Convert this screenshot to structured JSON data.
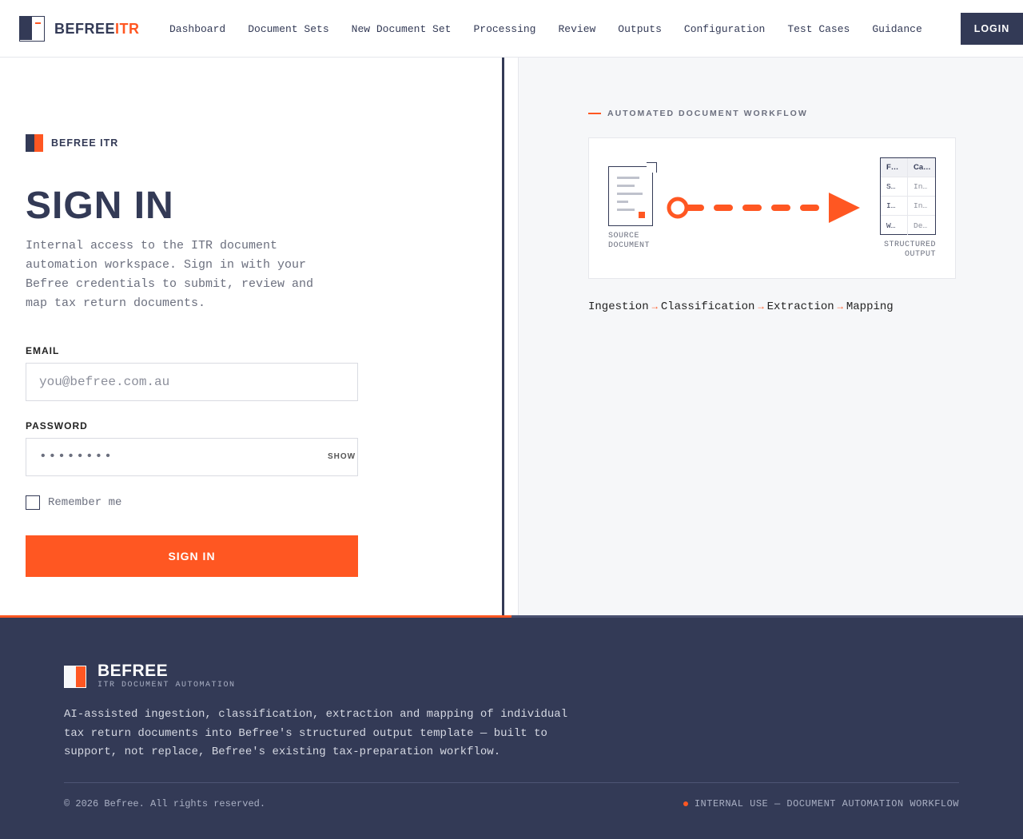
{
  "header": {
    "brand_main": "BEFREE",
    "brand_accent": "ITR",
    "nav": [
      "Dashboard",
      "Document Sets",
      "New Document Set",
      "Processing",
      "Review",
      "Outputs",
      "Configuration",
      "Test Cases",
      "Guidance"
    ],
    "login_label": "LOGIN"
  },
  "login": {
    "brand": "BEFREE ITR",
    "title": "SIGN IN",
    "description": "Internal access to the ITR document automation workspace. Sign in with your Befree credentials to submit, review and map tax return documents.",
    "email_label": "EMAIL",
    "email_placeholder": "you@befree.com.au",
    "password_label": "PASSWORD",
    "password_mask": "••••••••",
    "show_label": "SHOW",
    "remember_label": "Remember me",
    "submit_label": "SIGN IN"
  },
  "workflow": {
    "label": "AUTOMATED DOCUMENT WORKFLOW",
    "source_caption": [
      "SOURCE",
      "DOCUMENT"
    ],
    "output_caption": [
      "STRUCTURED",
      "OUTPUT"
    ],
    "table": [
      [
        "F…",
        "Ca…"
      ],
      [
        "S…",
        "In…"
      ],
      [
        "I…",
        "In…"
      ],
      [
        "W…",
        "De…"
      ]
    ],
    "steps": [
      "Ingestion",
      "Classification",
      "Extraction",
      "Mapping"
    ],
    "arrow": "→"
  },
  "footer": {
    "brand": "BEFREE",
    "tagline": "ITR DOCUMENT AUTOMATION",
    "description": "AI-assisted ingestion, classification, extraction and mapping of individual tax return documents into Befree's structured output template — built to support, not replace, Befree's existing tax-preparation workflow.",
    "copyright": "© 2026 Befree. All rights reserved.",
    "internal": "INTERNAL USE — DOCUMENT AUTOMATION WORKFLOW"
  },
  "colors": {
    "navy": "#333a56",
    "accent": "#ff5722",
    "panel": "#f6f7f9"
  }
}
